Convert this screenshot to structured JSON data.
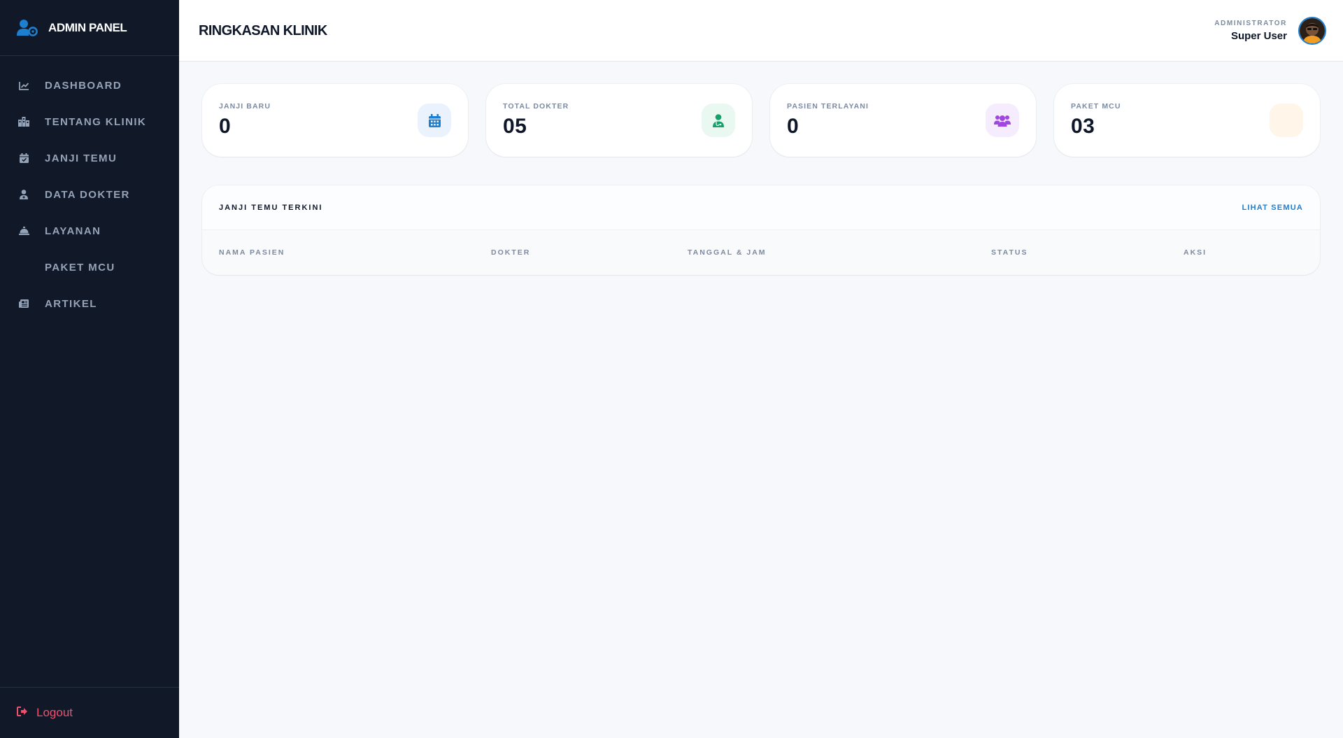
{
  "brand": {
    "title": "ADMIN PANEL",
    "icon": "user-gear-icon",
    "accent": "#1d7fd0"
  },
  "sidebar": {
    "items": [
      {
        "label": "DASHBOARD",
        "icon": "chart-line-icon"
      },
      {
        "label": "TENTANG KLINIK",
        "icon": "buildings-icon"
      },
      {
        "label": "JANJI TEMU",
        "icon": "calendar-check-icon"
      },
      {
        "label": "DATA DOKTER",
        "icon": "doctor-icon"
      },
      {
        "label": "LAYANAN",
        "icon": "bell-concierge-icon"
      },
      {
        "label": "PAKET MCU",
        "icon": ""
      },
      {
        "label": "ARTIKEL",
        "icon": "newspaper-icon"
      }
    ],
    "logout_label": "Logout",
    "logout_color": "#f0506e"
  },
  "header": {
    "title": "RINGKASAN KLINIK",
    "user_role": "ADMINISTRATOR",
    "user_name": "Super User"
  },
  "stats": [
    {
      "label": "JANJI BARU",
      "value": "0",
      "icon": "calendar-icon",
      "color": "#1d7fd0",
      "bg": "#eaf3fd"
    },
    {
      "label": "TOTAL DOKTER",
      "value": "05",
      "icon": "doctor-icon",
      "color": "#16a06a",
      "bg": "#e9f8f1"
    },
    {
      "label": "PASIEN TERLAYANI",
      "value": "0",
      "icon": "users-icon",
      "color": "#a146e0",
      "bg": "#f5ecfd"
    },
    {
      "label": "PAKET MCU",
      "value": "03",
      "icon": "",
      "color": "#f59e0b",
      "bg": "#fff5e9"
    }
  ],
  "recent": {
    "title": "JANJI TEMU TERKINI",
    "view_all": "LIHAT SEMUA",
    "columns": [
      "NAMA PASIEN",
      "DOKTER",
      "TANGGAL & JAM",
      "STATUS",
      "AKSI"
    ]
  }
}
